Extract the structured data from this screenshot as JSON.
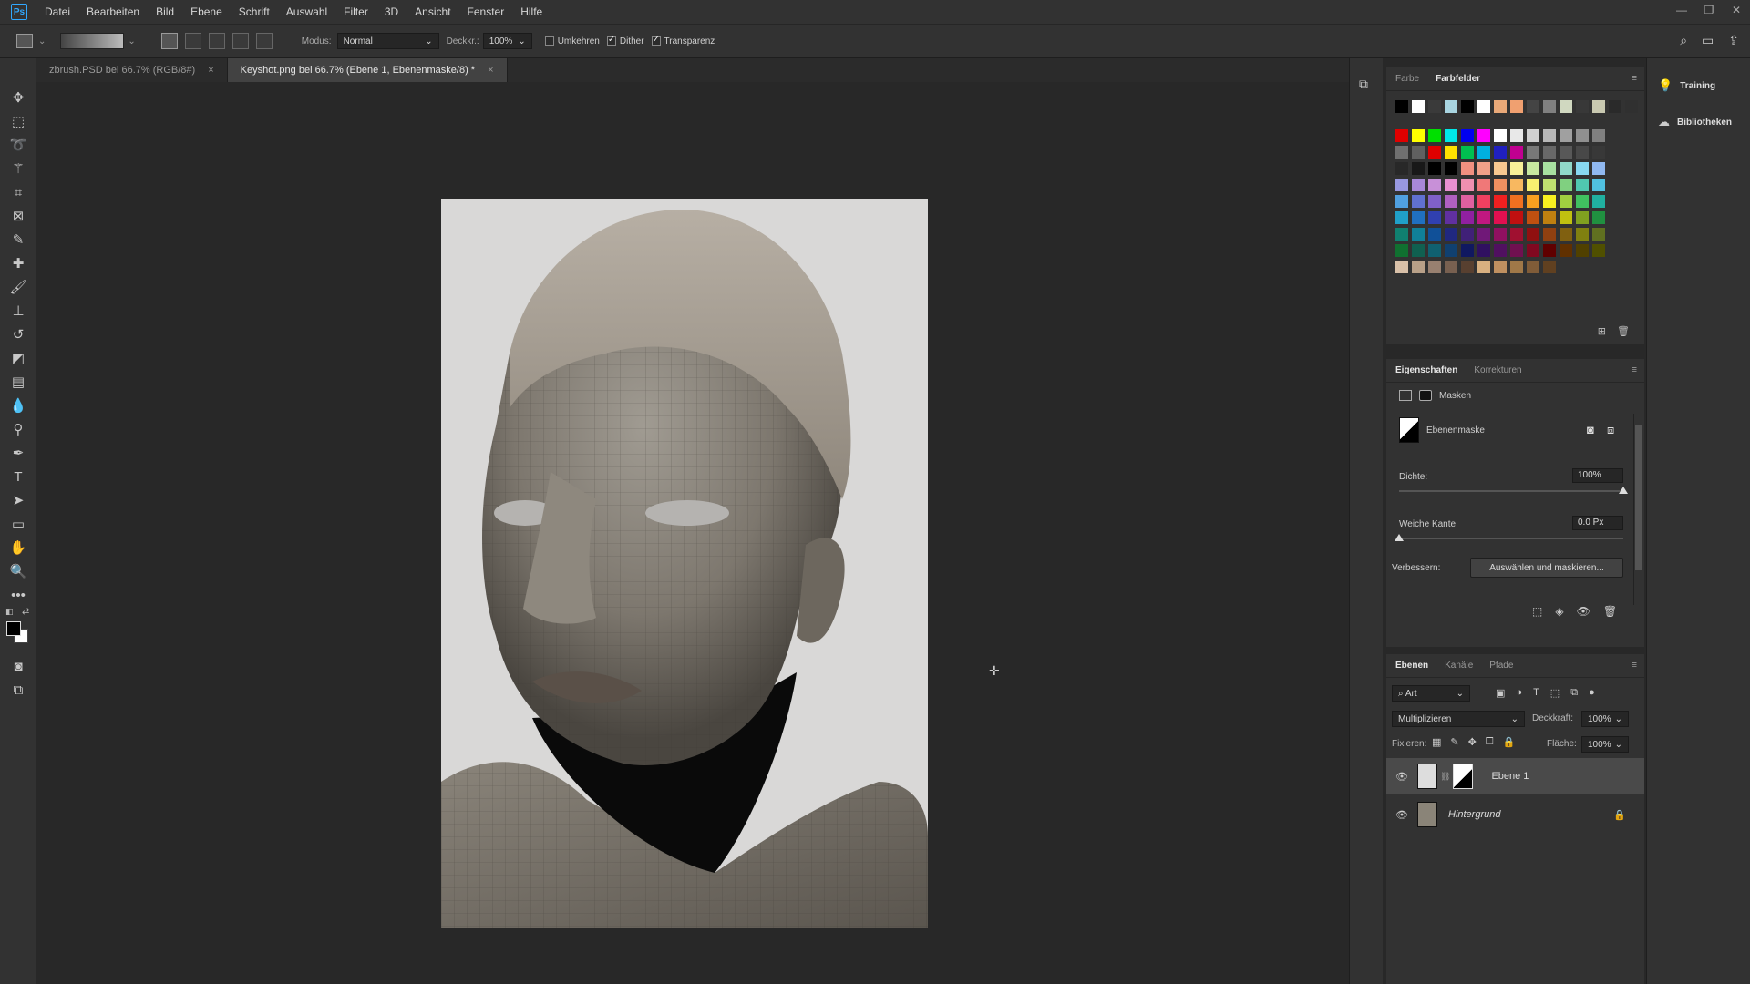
{
  "app": {
    "logo": "Ps"
  },
  "menu": [
    "Datei",
    "Bearbeiten",
    "Bild",
    "Ebene",
    "Schrift",
    "Auswahl",
    "Filter",
    "3D",
    "Ansicht",
    "Fenster",
    "Hilfe"
  ],
  "options": {
    "mode_label": "Modus:",
    "mode_value": "Normal",
    "opacity_label": "Deckkr.:",
    "opacity_value": "100%",
    "reverse_label": "Umkehren",
    "dither_label": "Dither",
    "transparency_label": "Transparenz"
  },
  "tabs": [
    {
      "label": "zbrush.PSD bei 66.7% (RGB/8#)",
      "close": "×"
    },
    {
      "label": "Keyshot.png bei 66.7% (Ebene 1, Ebenenmaske/8) *",
      "close": "×"
    }
  ],
  "swatches_panel": {
    "tabs": [
      "Farbe",
      "Farbfelder"
    ],
    "menu": "≡",
    "recent": [
      "#000000",
      "#ffffff",
      "#3a3a3a",
      "#a8d4e0",
      "#000000",
      "#ffffff",
      "#e8a878",
      "#f0a070",
      "#444444",
      "#808080",
      "#d0d8c0",
      "#383838",
      "#c8c8b0",
      "#2a2a2a",
      "#303030"
    ],
    "rows": [
      [
        "#e00000",
        "#ffff00",
        "#00e000",
        "#00e8e8",
        "#0000f0",
        "#ff00ff",
        "#ffffff",
        "#e8e8e8",
        "#d0d0d0",
        "#b8b8b8",
        "#a0a0a0",
        "#909090",
        "#808080"
      ],
      [
        "#707070",
        "#606060",
        "#e00000",
        "#ffe000",
        "#00c050",
        "#00b0e0",
        "#2020c0",
        "#c00090",
        "#787878",
        "#686868",
        "#585858",
        "#484848",
        "#383838"
      ],
      [
        "#282828",
        "#181818",
        "#000000",
        "#000000",
        "#f09080",
        "#f0a088",
        "#f8c890",
        "#f8f098",
        "#c8e8a0",
        "#a8e0a0",
        "#90d8c8",
        "#88d8f0",
        "#90b8f0"
      ],
      [
        "#9898e0",
        "#a888d8",
        "#c890d8",
        "#e890d0",
        "#f090b0",
        "#f07878",
        "#f09060",
        "#f8b860",
        "#f8f070",
        "#c0e070",
        "#80d080",
        "#50c8b0",
        "#50c0e0"
      ],
      [
        "#50a0e0",
        "#6070d0",
        "#8060c8",
        "#b060c0",
        "#e060a0",
        "#f04060",
        "#f02020",
        "#f07020",
        "#f8a020",
        "#f8f020",
        "#a0d040",
        "#40c060",
        "#20b0a0"
      ],
      [
        "#20a0c8",
        "#2070c0",
        "#3040b0",
        "#6030a0",
        "#9020a0",
        "#c01880",
        "#e01050",
        "#c01010",
        "#c05010",
        "#c08010",
        "#c0c010",
        "#80a020",
        "#209040"
      ],
      [
        "#108070",
        "#108098",
        "#105098",
        "#202880",
        "#402078",
        "#701878",
        "#901060",
        "#a01030",
        "#901010",
        "#904010",
        "#806010",
        "#808010",
        "#607020"
      ],
      [
        "#107030",
        "#106050",
        "#106070",
        "#104070",
        "#101860",
        "#301060",
        "#501060",
        "#701050",
        "#800820",
        "#600000",
        "#603000",
        "#504000",
        "#505000"
      ],
      [
        "#d8c0a8",
        "#b8a088",
        "#988070",
        "#786050",
        "#584030",
        "#d8b080",
        "#c09060",
        "#a07848",
        "#805c38",
        "#604020"
      ]
    ],
    "new_icon": "new-swatch-icon",
    "delete_icon": "trash-icon"
  },
  "properties_panel": {
    "tabs": [
      "Eigenschaften",
      "Korrekturen"
    ],
    "masks_label": "Masken",
    "mask_type": "Ebenenmaske",
    "density_label": "Dichte:",
    "density_value": "100%",
    "density_level": 1.0,
    "feather_label": "Weiche Kante:",
    "feather_value": "0.0 Px",
    "feather_level": 0.0,
    "refine_label": "Verbessern:",
    "refine_button": "Auswählen und maskieren..."
  },
  "layers_panel": {
    "tabs": [
      "Ebenen",
      "Kanäle",
      "Pfade"
    ],
    "filter_label": "Art",
    "blend_mode": "Multiplizieren",
    "opacity_label": "Deckkraft:",
    "opacity_value": "100%",
    "lock_label": "Fixieren:",
    "fill_label": "Fläche:",
    "fill_value": "100%",
    "layers": [
      {
        "name": "Ebene 1",
        "selected": true,
        "has_mask": true
      },
      {
        "name": "Hintergrund",
        "selected": false,
        "locked": true
      }
    ]
  },
  "right_strip": {
    "training": "Training",
    "libraries": "Bibliotheken"
  }
}
